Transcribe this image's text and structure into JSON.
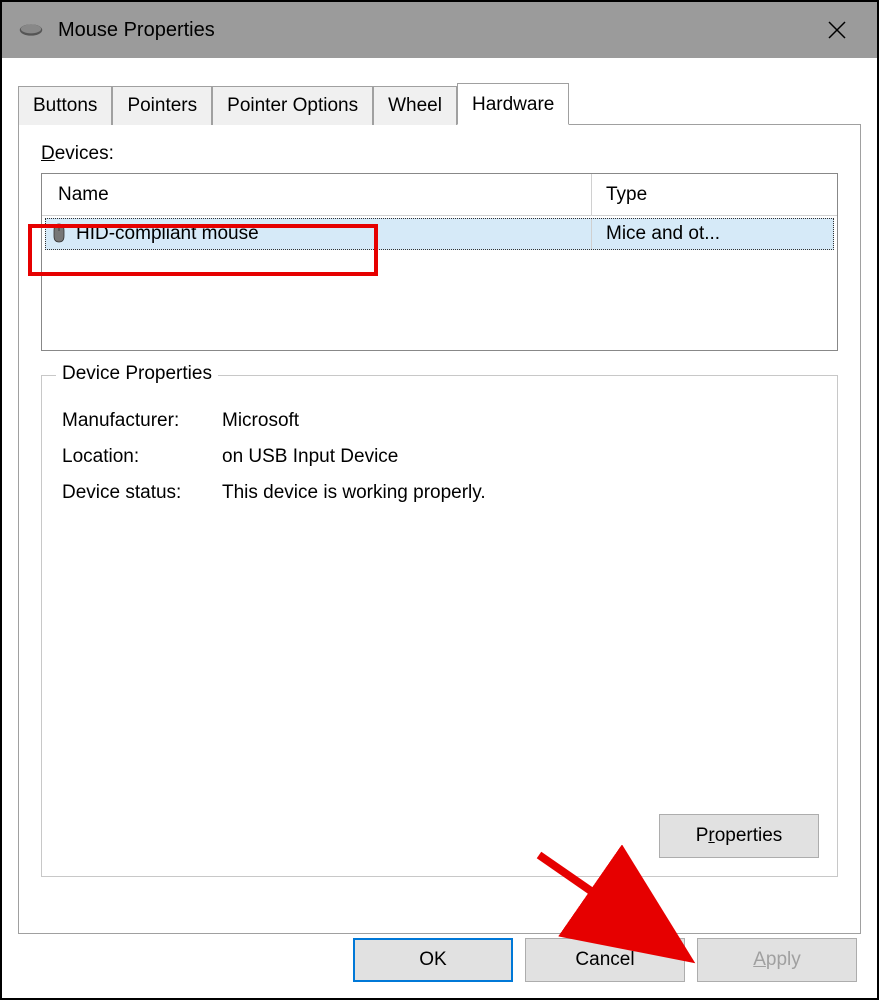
{
  "window": {
    "title": "Mouse Properties"
  },
  "tabs": {
    "buttons": "Buttons",
    "pointers": "Pointers",
    "pointer_options": "Pointer Options",
    "wheel": "Wheel",
    "hardware": "Hardware"
  },
  "devices_section": {
    "label": "Devices:",
    "columns": {
      "name": "Name",
      "type": "Type"
    },
    "rows": [
      {
        "name": "HID-compliant mouse",
        "type": "Mice and ot..."
      }
    ]
  },
  "device_properties": {
    "legend": "Device Properties",
    "manufacturer_label": "Manufacturer:",
    "manufacturer_value": "Microsoft",
    "location_label": "Location:",
    "location_value": "on USB Input Device",
    "status_label": "Device status:",
    "status_value": "This device is working properly.",
    "properties_btn_prefix": "P",
    "properties_btn_u": "r",
    "properties_btn_suffix": "operties"
  },
  "buttons": {
    "ok": "OK",
    "cancel": "Cancel",
    "apply_u": "A",
    "apply_suffix": "pply"
  }
}
